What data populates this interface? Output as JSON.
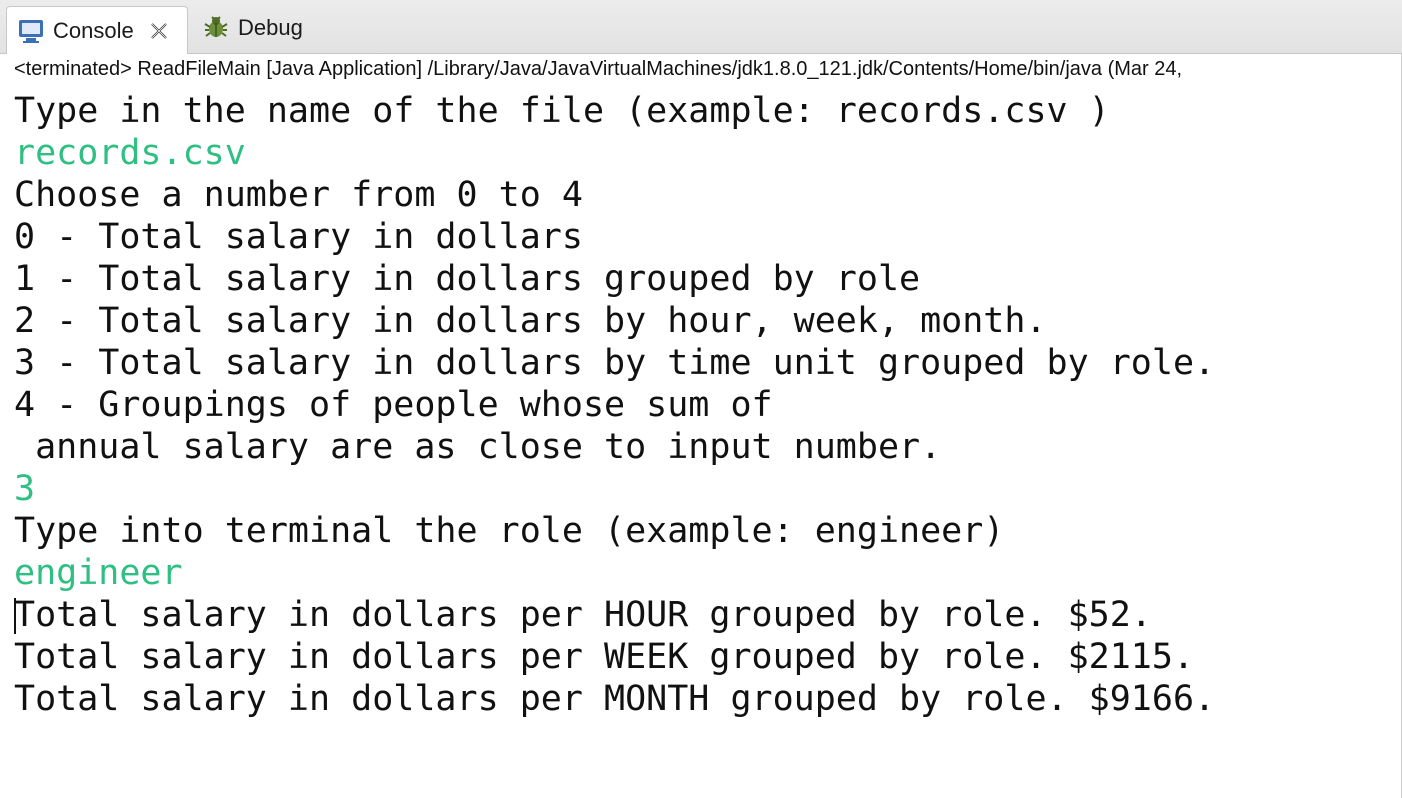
{
  "tabs": [
    {
      "label": "Console",
      "icon": "console-icon",
      "active": true
    },
    {
      "label": "Debug",
      "icon": "bug-icon",
      "active": false
    }
  ],
  "status_line": "<terminated> ReadFileMain [Java Application] /Library/Java/JavaVirtualMachines/jdk1.8.0_121.jdk/Contents/Home/bin/java (Mar 24,",
  "console": {
    "lines": [
      {
        "text": "Type in the name of the file (example: records.csv )",
        "kind": "output"
      },
      {
        "text": "records.csv",
        "kind": "input"
      },
      {
        "text": "Choose a number from 0 to 4",
        "kind": "output"
      },
      {
        "text": "0 - Total salary in dollars",
        "kind": "output"
      },
      {
        "text": "1 - Total salary in dollars grouped by role",
        "kind": "output"
      },
      {
        "text": "2 - Total salary in dollars by hour, week, month.",
        "kind": "output"
      },
      {
        "text": "3 - Total salary in dollars by time unit grouped by role.",
        "kind": "output"
      },
      {
        "text": "4 - Groupings of people whose sum of",
        "kind": "output"
      },
      {
        "text": " annual salary are as close to input number.",
        "kind": "output"
      },
      {
        "text": "3",
        "kind": "input"
      },
      {
        "text": "Type into terminal the role (example: engineer)",
        "kind": "output"
      },
      {
        "text": "engineer",
        "kind": "input"
      },
      {
        "text": "Total salary in dollars per HOUR grouped by role. $52.",
        "kind": "output"
      },
      {
        "text": "Total salary in dollars per WEEK grouped by role. $2115.",
        "kind": "output"
      },
      {
        "text": "Total salary in dollars per MONTH grouped by role. $9166.",
        "kind": "output"
      }
    ],
    "input_color": "#2fbf83",
    "output_color": "#111111"
  }
}
